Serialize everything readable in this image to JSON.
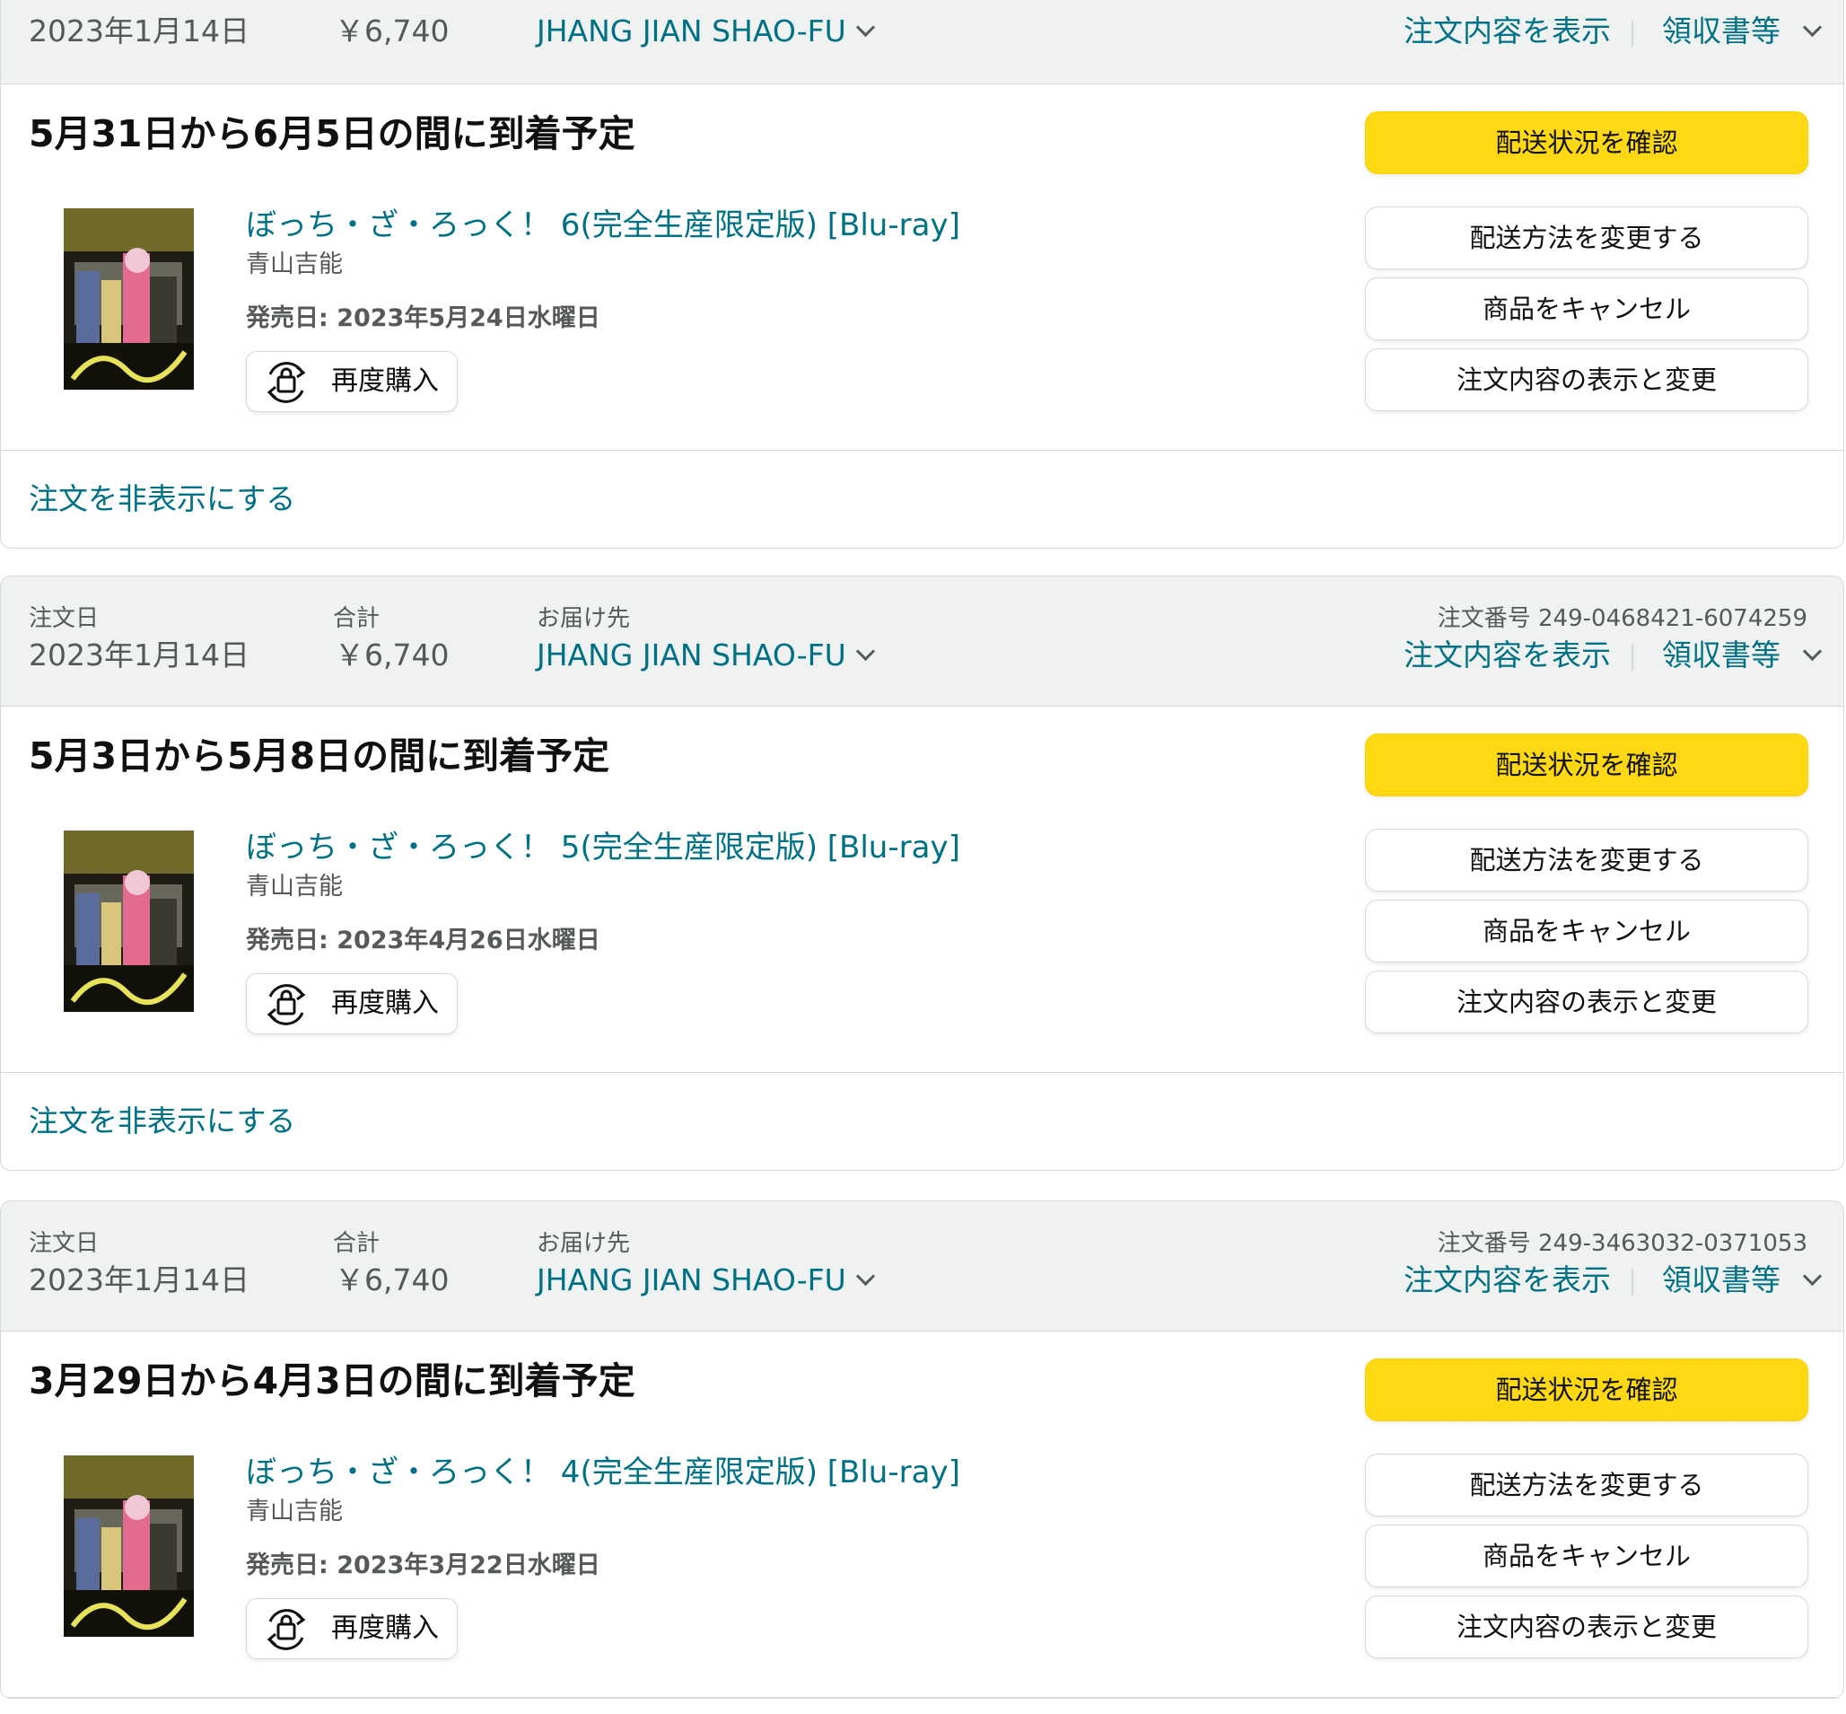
{
  "labels": {
    "order_date": "注文日",
    "total": "合計",
    "ship_to": "お届け先",
    "order_number": "注文番号",
    "view_order": "注文内容を表示",
    "receipt": "領収書等",
    "track": "配送状況を確認",
    "change_shipping": "配送方法を変更する",
    "cancel": "商品をキャンセル",
    "view_edit": "注文内容の表示と変更",
    "buy_again": "再度購入",
    "hide_order": "注文を非表示にする"
  },
  "orders": [
    {
      "date": "2023年1月14日",
      "total": "￥6,740",
      "recipient": "JHANG JIAN SHAO-FU",
      "order_number": "",
      "delivery": "5月31日から6月5日の間に到着予定",
      "product_title": "ぼっち・ざ・ろっく！ 6(完全生産限定版) [Blu-ray]",
      "author": "青山吉能",
      "release": "発売日: 2023年5月24日水曜日"
    },
    {
      "date": "2023年1月14日",
      "total": "￥6,740",
      "recipient": "JHANG JIAN SHAO-FU",
      "order_number": "249-0468421-6074259",
      "delivery": "5月3日から5月8日の間に到着予定",
      "product_title": "ぼっち・ざ・ろっく！ 5(完全生産限定版) [Blu-ray]",
      "author": "青山吉能",
      "release": "発売日: 2023年4月26日水曜日"
    },
    {
      "date": "2023年1月14日",
      "total": "￥6,740",
      "recipient": "JHANG JIAN SHAO-FU",
      "order_number": "249-3463032-0371053",
      "delivery": "3月29日から4月3日の間に到着予定",
      "product_title": "ぼっち・ざ・ろっく！ 4(完全生産限定版) [Blu-ray]",
      "author": "青山吉能",
      "release": "発売日: 2023年3月22日水曜日"
    }
  ],
  "colors": {
    "link": "#007185",
    "primary_button": "#ffd814",
    "header_bg": "#f0f2f2",
    "border": "#d5d9d9"
  },
  "icons": {
    "buy_again": "bag-refresh-icon",
    "dropdown": "chevron-down-icon"
  }
}
